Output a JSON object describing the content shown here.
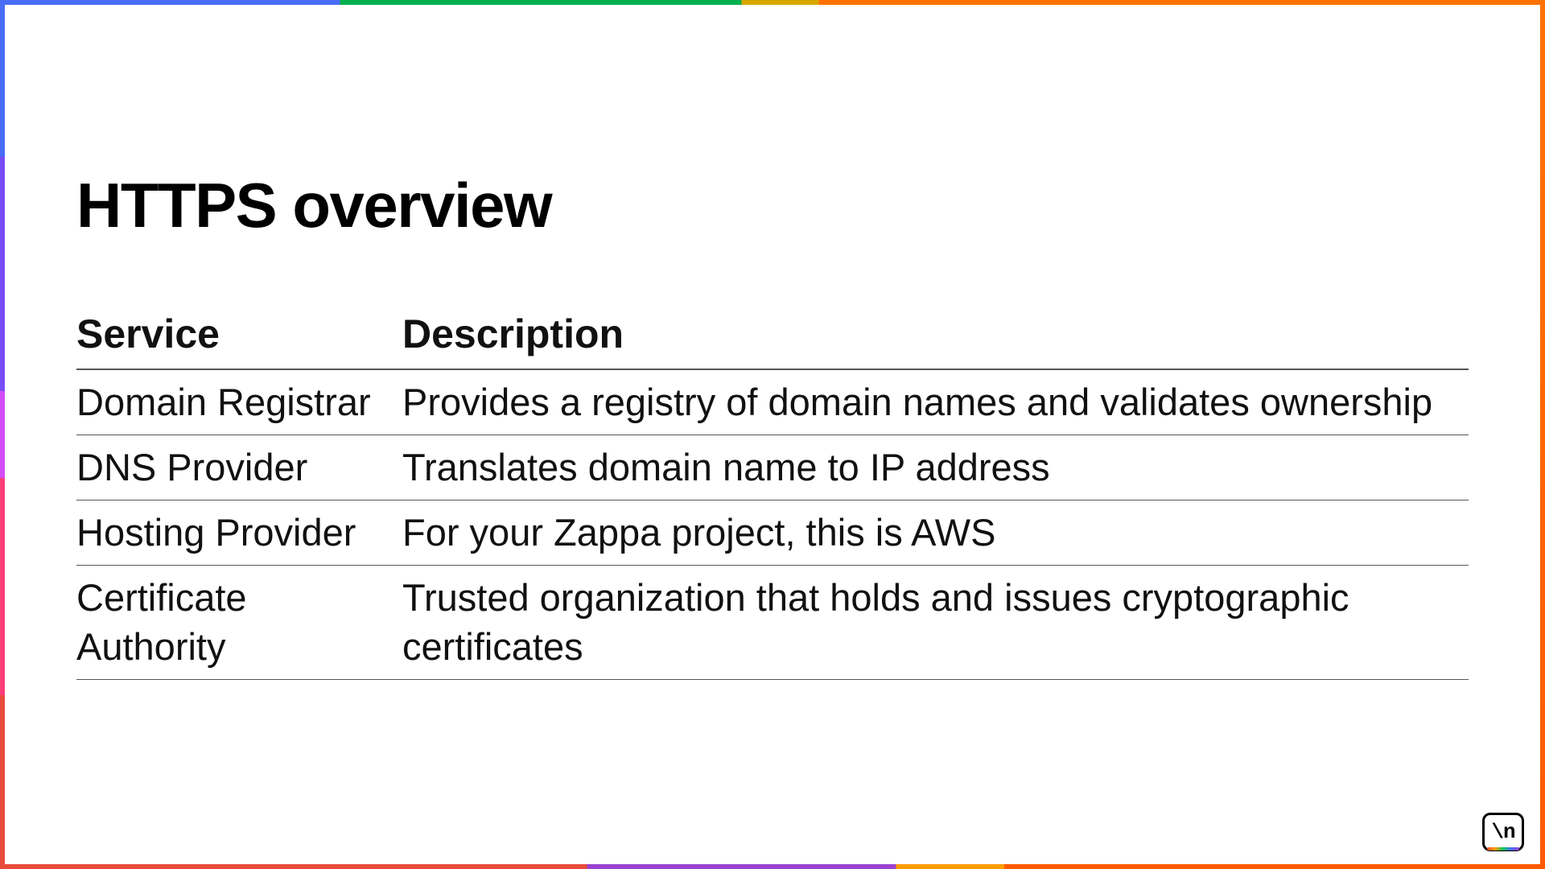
{
  "title": "HTTPS overview",
  "table": {
    "headers": [
      "Service",
      "Description"
    ],
    "rows": [
      {
        "service": "Domain Registrar",
        "description": "Provides a registry of domain names and validates ownership"
      },
      {
        "service": "DNS Provider",
        "description": "Translates domain name to IP address"
      },
      {
        "service": "Hosting Provider",
        "description": "For your Zappa project, this is AWS"
      },
      {
        "service": "Certificate Authority",
        "description": "Trusted organization that holds and issues cryptographic certificates"
      }
    ]
  },
  "logo_text": "\\n"
}
